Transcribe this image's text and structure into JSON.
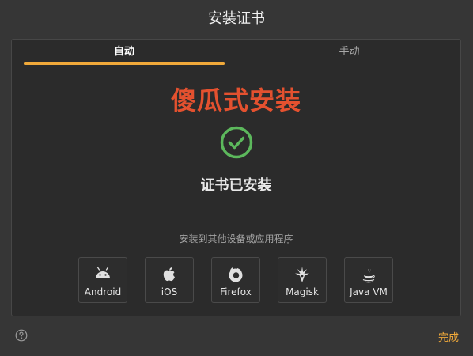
{
  "dialog": {
    "title": "安装证书"
  },
  "tabs": [
    {
      "label": "自动",
      "active": true
    },
    {
      "label": "手动",
      "active": false
    }
  ],
  "main": {
    "headline": "傻瓜式安装",
    "status_text": "证书已安装",
    "other_label": "安装到其他设备或应用程序"
  },
  "platforms": [
    {
      "label": "Android",
      "icon": "android-icon"
    },
    {
      "label": "iOS",
      "icon": "apple-icon"
    },
    {
      "label": "Firefox",
      "icon": "firefox-icon"
    },
    {
      "label": "Magisk",
      "icon": "magisk-icon"
    },
    {
      "label": "Java VM",
      "icon": "java-icon"
    }
  ],
  "footer": {
    "done_label": "完成"
  },
  "colors": {
    "accent": "#f0a93a",
    "headline": "#e4512f",
    "success": "#5cb85c"
  }
}
